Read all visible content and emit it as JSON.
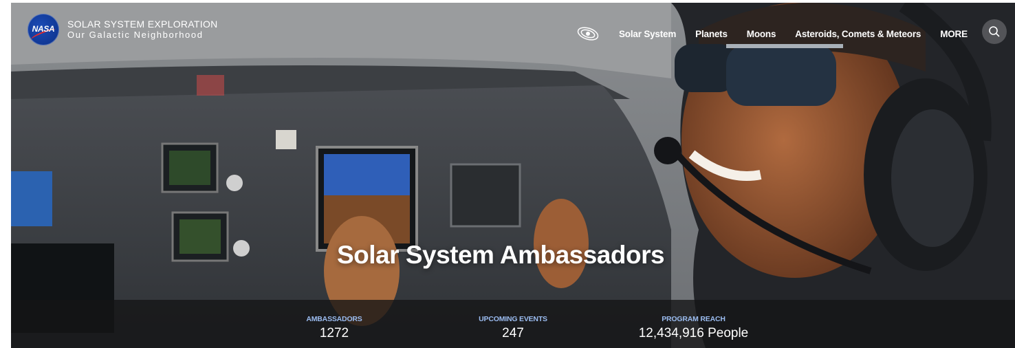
{
  "brand": {
    "title": "SOLAR SYSTEM EXPLORATION",
    "subtitle": "Our Galactic Neighborhood",
    "logo_text": "NASA"
  },
  "nav": {
    "icon": "orbit-icon",
    "items": [
      {
        "label": "Solar System"
      },
      {
        "label": "Planets"
      },
      {
        "label": "Moons"
      },
      {
        "label": "Asteroids, Comets & Meteors"
      },
      {
        "label": "MORE"
      }
    ],
    "search_icon": "search-icon"
  },
  "hero": {
    "title": "Solar System Ambassadors"
  },
  "stats": [
    {
      "label": "AMBASSADORS",
      "value": "1272"
    },
    {
      "label": "UPCOMING EVENTS",
      "value": "247"
    },
    {
      "label": "PROGRAM REACH",
      "value": "12,434,916 People"
    }
  ],
  "colors": {
    "stat_label": "#9bbcf0",
    "nasa_blue": "#0b3d91",
    "nasa_red": "#e32d2d"
  }
}
